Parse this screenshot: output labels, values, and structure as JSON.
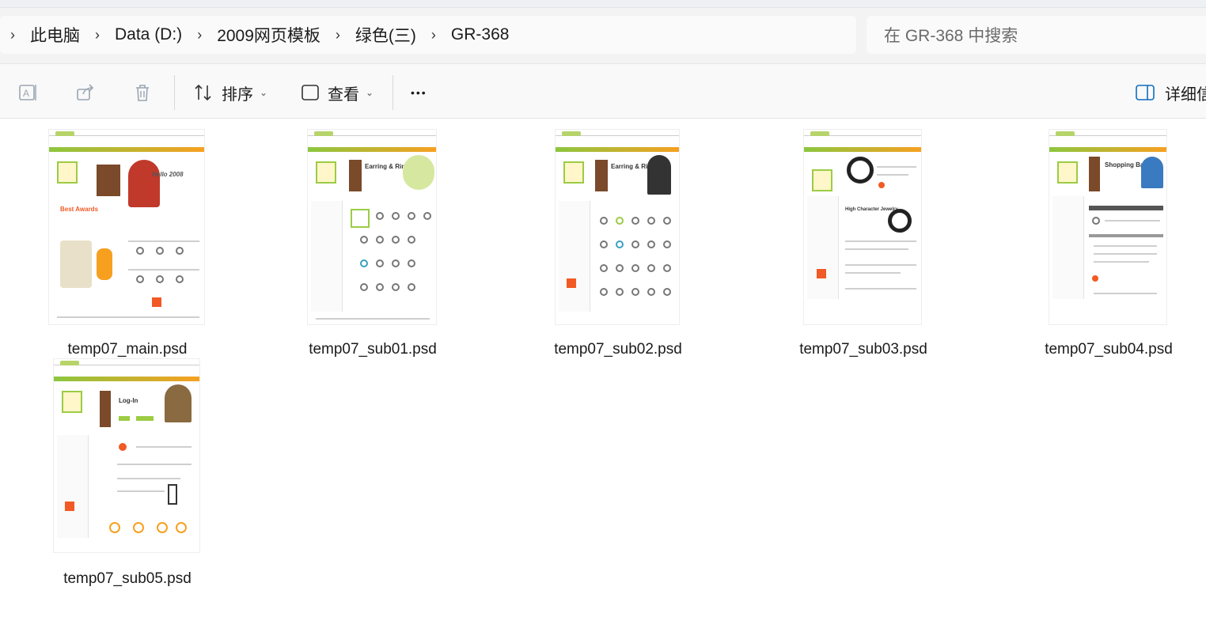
{
  "breadcrumb": {
    "items": [
      "此电脑",
      "Data (D:)",
      "2009网页模板",
      "绿色(三)",
      "GR-368"
    ]
  },
  "search": {
    "placeholder": "在 GR-368 中搜索"
  },
  "toolbar": {
    "sort_label": "排序",
    "view_label": "查看",
    "more_label": "•••",
    "details_label": "详细信"
  },
  "files": [
    {
      "name": "temp07_main.psd",
      "thumb_text": "Hello 2008",
      "thumb_sub": "Best Awards"
    },
    {
      "name": "temp07_sub01.psd",
      "thumb_text": "Earring & Ring"
    },
    {
      "name": "temp07_sub02.psd",
      "thumb_text": "Earring & Ring"
    },
    {
      "name": "temp07_sub03.psd",
      "thumb_text": "High Character Jewelry"
    },
    {
      "name": "temp07_sub04.psd",
      "thumb_text": "Shopping Basket"
    },
    {
      "name": "temp07_sub05.psd",
      "thumb_text": "Log-In"
    }
  ],
  "colors": {
    "accent_green": "#8cc63f",
    "accent_orange": "#f15a24",
    "toolbar_bg": "#f9f9f9",
    "address_bg": "#f3f3f3"
  }
}
